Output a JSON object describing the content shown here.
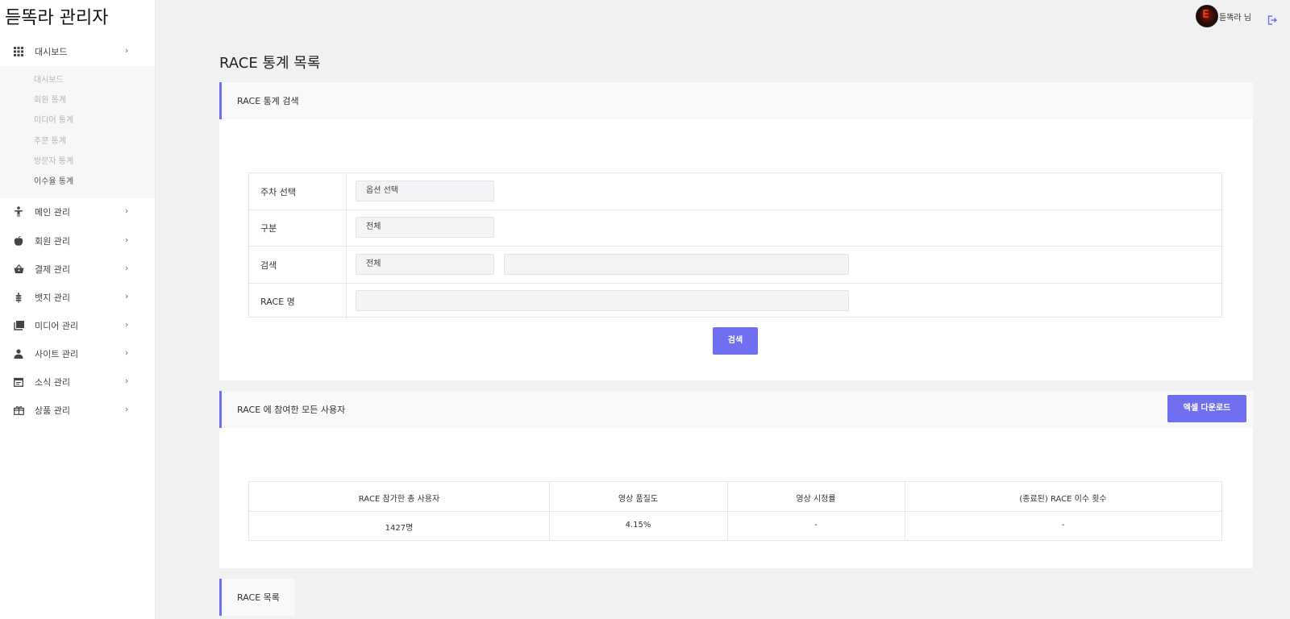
{
  "app": {
    "title": "듣똑라 관리자"
  },
  "topbar": {
    "user_name": "듣똑라 님"
  },
  "sidebar": {
    "dashboard": {
      "label": "대시보드"
    },
    "dashboard_sub": [
      "대시보드",
      "회원 통계",
      "미디어 통계",
      "주문 통계",
      "방문자 통계",
      "이수율 통계"
    ],
    "items": [
      {
        "label": "메인 관리",
        "icon": "person-icon"
      },
      {
        "label": "회원 관리",
        "icon": "apple-icon"
      },
      {
        "label": "결제 관리",
        "icon": "basket-icon"
      },
      {
        "label": "뱃지 관리",
        "icon": "wheat-icon"
      },
      {
        "label": "미디어 관리",
        "icon": "library-icon"
      },
      {
        "label": "사이트 관리",
        "icon": "user-icon"
      },
      {
        "label": "소식 관리",
        "icon": "calendar-icon"
      },
      {
        "label": "상품 관리",
        "icon": "gift-icon"
      }
    ]
  },
  "page": {
    "title": "RACE 통계 목록"
  },
  "search_card": {
    "header": "RACE 통계 검색",
    "rows": {
      "week": {
        "label": "주차 선택",
        "value": "옵션 선택"
      },
      "category": {
        "label": "구분",
        "value": "전체"
      },
      "search": {
        "label": "검색",
        "value": "전체",
        "keyword": ""
      },
      "race_name": {
        "label": "RACE 명",
        "value": ""
      }
    },
    "search_button": "검색"
  },
  "stats_card": {
    "header": "RACE 에 참여한 모든 사용자",
    "excel_button": "엑셀 다운로드",
    "columns": [
      "RACE 참가한 총 사용자",
      "영상 품질도",
      "영상 시청률",
      "(종료된) RACE 이수 횟수"
    ],
    "values": [
      "1427명",
      "4.15%",
      "-",
      "-"
    ]
  },
  "list_card": {
    "header": "RACE 목록"
  },
  "colors": {
    "accent": "#6f6ff0"
  }
}
